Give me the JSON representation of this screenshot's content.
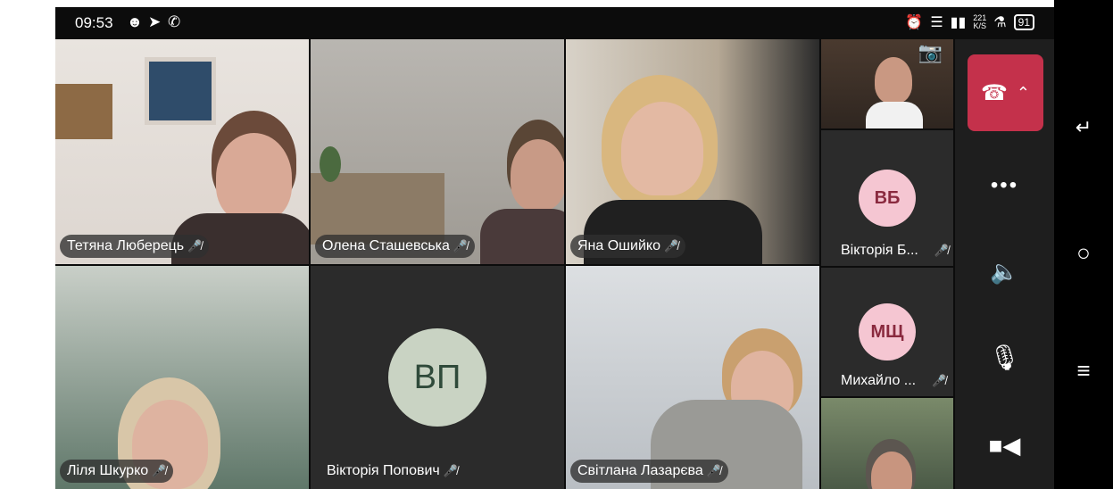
{
  "status_bar": {
    "time": "09:53",
    "left_icons": [
      "teams-icon",
      "telegram-icon",
      "viber-icon"
    ],
    "net_speed_top": "221",
    "net_speed_unit": "K/S",
    "battery": "91"
  },
  "participants": [
    {
      "name": "Тетяна Люберець",
      "muted": true
    },
    {
      "name": "Олена Сташевська",
      "muted": true
    },
    {
      "name": "Яна Ошийко",
      "muted": true
    },
    {
      "name": "Ліля Шкурко",
      "muted": true
    },
    {
      "name": "Вікторія Попович",
      "muted": true,
      "initials": "ВП"
    },
    {
      "name": "Світлана Лазарєва",
      "muted": true
    }
  ],
  "side_participants": [
    {
      "name": "Вікторія Б...",
      "initials": "ВБ",
      "muted": true
    },
    {
      "name": "Михайло ...",
      "initials": "МЩ",
      "muted": true
    }
  ],
  "colors": {
    "hangup": "#c4314b",
    "avatar_light": "#f5c6d2",
    "avatar_green": "#c9d3c3"
  }
}
